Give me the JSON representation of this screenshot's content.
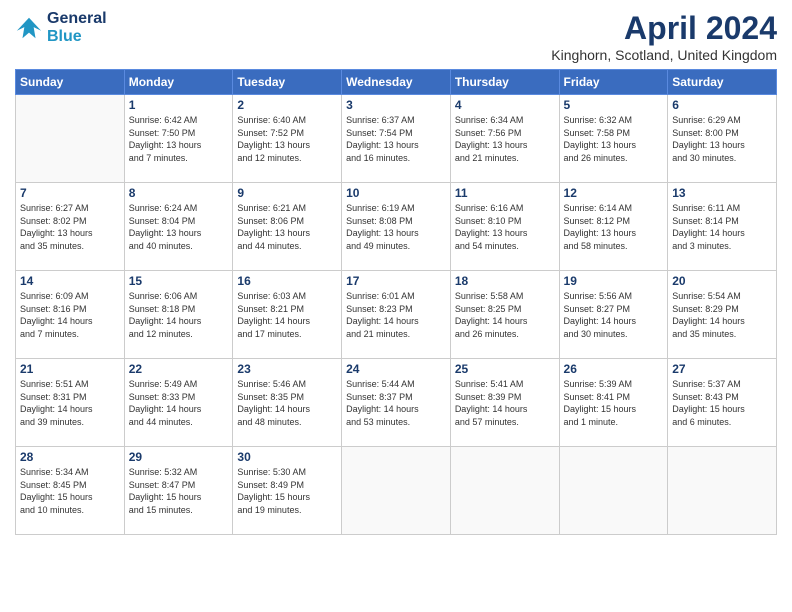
{
  "logo": {
    "line1": "General",
    "line2": "Blue"
  },
  "title": "April 2024",
  "subtitle": "Kinghorn, Scotland, United Kingdom",
  "days_of_week": [
    "Sunday",
    "Monday",
    "Tuesday",
    "Wednesday",
    "Thursday",
    "Friday",
    "Saturday"
  ],
  "weeks": [
    [
      {
        "day": "",
        "info": ""
      },
      {
        "day": "1",
        "info": "Sunrise: 6:42 AM\nSunset: 7:50 PM\nDaylight: 13 hours\nand 7 minutes."
      },
      {
        "day": "2",
        "info": "Sunrise: 6:40 AM\nSunset: 7:52 PM\nDaylight: 13 hours\nand 12 minutes."
      },
      {
        "day": "3",
        "info": "Sunrise: 6:37 AM\nSunset: 7:54 PM\nDaylight: 13 hours\nand 16 minutes."
      },
      {
        "day": "4",
        "info": "Sunrise: 6:34 AM\nSunset: 7:56 PM\nDaylight: 13 hours\nand 21 minutes."
      },
      {
        "day": "5",
        "info": "Sunrise: 6:32 AM\nSunset: 7:58 PM\nDaylight: 13 hours\nand 26 minutes."
      },
      {
        "day": "6",
        "info": "Sunrise: 6:29 AM\nSunset: 8:00 PM\nDaylight: 13 hours\nand 30 minutes."
      }
    ],
    [
      {
        "day": "7",
        "info": "Sunrise: 6:27 AM\nSunset: 8:02 PM\nDaylight: 13 hours\nand 35 minutes."
      },
      {
        "day": "8",
        "info": "Sunrise: 6:24 AM\nSunset: 8:04 PM\nDaylight: 13 hours\nand 40 minutes."
      },
      {
        "day": "9",
        "info": "Sunrise: 6:21 AM\nSunset: 8:06 PM\nDaylight: 13 hours\nand 44 minutes."
      },
      {
        "day": "10",
        "info": "Sunrise: 6:19 AM\nSunset: 8:08 PM\nDaylight: 13 hours\nand 49 minutes."
      },
      {
        "day": "11",
        "info": "Sunrise: 6:16 AM\nSunset: 8:10 PM\nDaylight: 13 hours\nand 54 minutes."
      },
      {
        "day": "12",
        "info": "Sunrise: 6:14 AM\nSunset: 8:12 PM\nDaylight: 13 hours\nand 58 minutes."
      },
      {
        "day": "13",
        "info": "Sunrise: 6:11 AM\nSunset: 8:14 PM\nDaylight: 14 hours\nand 3 minutes."
      }
    ],
    [
      {
        "day": "14",
        "info": "Sunrise: 6:09 AM\nSunset: 8:16 PM\nDaylight: 14 hours\nand 7 minutes."
      },
      {
        "day": "15",
        "info": "Sunrise: 6:06 AM\nSunset: 8:18 PM\nDaylight: 14 hours\nand 12 minutes."
      },
      {
        "day": "16",
        "info": "Sunrise: 6:03 AM\nSunset: 8:21 PM\nDaylight: 14 hours\nand 17 minutes."
      },
      {
        "day": "17",
        "info": "Sunrise: 6:01 AM\nSunset: 8:23 PM\nDaylight: 14 hours\nand 21 minutes."
      },
      {
        "day": "18",
        "info": "Sunrise: 5:58 AM\nSunset: 8:25 PM\nDaylight: 14 hours\nand 26 minutes."
      },
      {
        "day": "19",
        "info": "Sunrise: 5:56 AM\nSunset: 8:27 PM\nDaylight: 14 hours\nand 30 minutes."
      },
      {
        "day": "20",
        "info": "Sunrise: 5:54 AM\nSunset: 8:29 PM\nDaylight: 14 hours\nand 35 minutes."
      }
    ],
    [
      {
        "day": "21",
        "info": "Sunrise: 5:51 AM\nSunset: 8:31 PM\nDaylight: 14 hours\nand 39 minutes."
      },
      {
        "day": "22",
        "info": "Sunrise: 5:49 AM\nSunset: 8:33 PM\nDaylight: 14 hours\nand 44 minutes."
      },
      {
        "day": "23",
        "info": "Sunrise: 5:46 AM\nSunset: 8:35 PM\nDaylight: 14 hours\nand 48 minutes."
      },
      {
        "day": "24",
        "info": "Sunrise: 5:44 AM\nSunset: 8:37 PM\nDaylight: 14 hours\nand 53 minutes."
      },
      {
        "day": "25",
        "info": "Sunrise: 5:41 AM\nSunset: 8:39 PM\nDaylight: 14 hours\nand 57 minutes."
      },
      {
        "day": "26",
        "info": "Sunrise: 5:39 AM\nSunset: 8:41 PM\nDaylight: 15 hours\nand 1 minute."
      },
      {
        "day": "27",
        "info": "Sunrise: 5:37 AM\nSunset: 8:43 PM\nDaylight: 15 hours\nand 6 minutes."
      }
    ],
    [
      {
        "day": "28",
        "info": "Sunrise: 5:34 AM\nSunset: 8:45 PM\nDaylight: 15 hours\nand 10 minutes."
      },
      {
        "day": "29",
        "info": "Sunrise: 5:32 AM\nSunset: 8:47 PM\nDaylight: 15 hours\nand 15 minutes."
      },
      {
        "day": "30",
        "info": "Sunrise: 5:30 AM\nSunset: 8:49 PM\nDaylight: 15 hours\nand 19 minutes."
      },
      {
        "day": "",
        "info": ""
      },
      {
        "day": "",
        "info": ""
      },
      {
        "day": "",
        "info": ""
      },
      {
        "day": "",
        "info": ""
      }
    ]
  ]
}
